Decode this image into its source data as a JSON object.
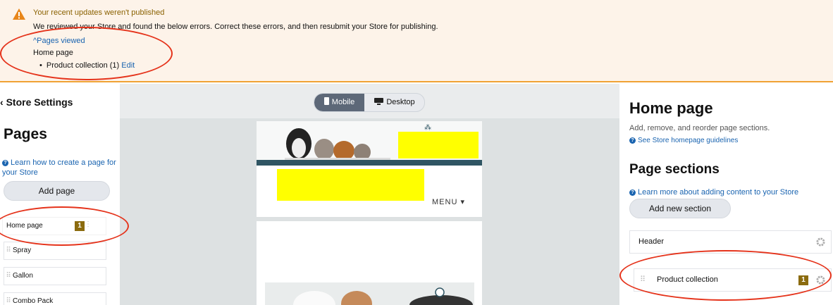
{
  "alert": {
    "title": "Your recent updates weren't published",
    "description": "We reviewed your Store and found the below errors. Correct these errors, and then resubmit your Store for publishing.",
    "toggle_label": "^Pages viewed",
    "page_name": "Home page",
    "item_label": "Product collection (1)",
    "edit_label": "Edit",
    "icon": "warning-icon",
    "accent_color": "#f0a234"
  },
  "sidebar": {
    "back_label": "Store Settings",
    "title": "Pages",
    "learn_link": "Learn how to create a page for your Store",
    "add_page_label": "Add page",
    "pages": [
      {
        "label": "Home page",
        "badge": "1"
      },
      {
        "label": "Spray"
      },
      {
        "label": "Gallon"
      },
      {
        "label": "Combo Pack"
      }
    ]
  },
  "canvas": {
    "mobile_label": "Mobile",
    "desktop_label": "Desktop",
    "menu_label": "MENU ▾"
  },
  "panel": {
    "title": "Home page",
    "description": "Add, remove, and reorder page sections.",
    "guidelines_link": "See Store homepage guidelines",
    "sections_title": "Page sections",
    "learn_link": "Learn more about adding content to your Store",
    "add_section_label": "Add new section",
    "sections": [
      {
        "label": "Header"
      },
      {
        "label": "Product collection",
        "badge": "1"
      }
    ]
  },
  "colors": {
    "badge": "#8b6b0e",
    "link": "#1a64b0",
    "annotation": "#e5331b",
    "redaction": "#ffff00"
  }
}
